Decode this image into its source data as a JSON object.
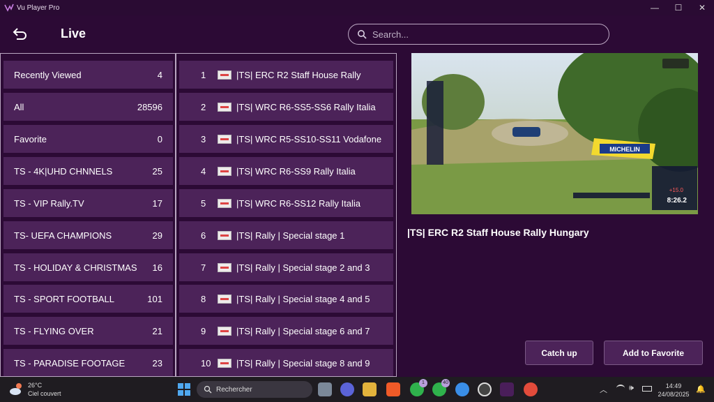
{
  "window": {
    "title": "Vu Player Pro",
    "minimize": "—",
    "maximize": "☐",
    "close": "✕"
  },
  "header": {
    "title": "Live",
    "search_placeholder": "Search..."
  },
  "categories": [
    {
      "name": "Recently Viewed",
      "count": "4"
    },
    {
      "name": "All",
      "count": "28596"
    },
    {
      "name": "Favorite",
      "count": "0"
    },
    {
      "name": "TS - 4K|UHD CHNNELS",
      "count": "25"
    },
    {
      "name": "TS - VIP Rally.TV",
      "count": "17"
    },
    {
      "name": "TS- UEFA CHAMPIONS",
      "count": "29"
    },
    {
      "name": "TS - HOLIDAY & CHRISTMAS",
      "count": "16"
    },
    {
      "name": "TS - SPORT FOOTBALL",
      "count": "101"
    },
    {
      "name": "TS - FLYING OVER",
      "count": "21"
    },
    {
      "name": "TS - PARADISE FOOTAGE",
      "count": "23"
    }
  ],
  "channels": [
    {
      "num": "1",
      "name": "|TS| ERC R2 Staff House Rally"
    },
    {
      "num": "2",
      "name": "|TS| WRC R6-SS5-SS6 Rally Italia"
    },
    {
      "num": "3",
      "name": "|TS| WRC R5-SS10-SS11 Vodafone"
    },
    {
      "num": "4",
      "name": "|TS| WRC R6-SS9 Rally Italia"
    },
    {
      "num": "5",
      "name": "|TS| WRC R6-SS12 Rally Italia"
    },
    {
      "num": "6",
      "name": "|TS| Rally | Special stage 1"
    },
    {
      "num": "7",
      "name": "|TS| Rally | Special stage 2 and 3"
    },
    {
      "num": "8",
      "name": "|TS| Rally | Special stage 4 and 5"
    },
    {
      "num": "9",
      "name": "|TS| Rally | Special stage 6 and 7"
    },
    {
      "num": "10",
      "name": "|TS| Rally | Special stage 8 and 9"
    }
  ],
  "preview": {
    "title": "|TS| ERC R2 Staff House Rally Hungary",
    "sponsor": "MICHELIN",
    "timer": "8:26.2",
    "delta": "+15.0"
  },
  "actions": {
    "catch_up": "Catch up",
    "add_favorite": "Add to Favorite"
  },
  "taskbar": {
    "temperature": "26°C",
    "weather": "Ciel couvert",
    "search": "Rechercher",
    "time": "14:49",
    "date": "24/08/2025",
    "badge_whatsapp": "1",
    "badge_whatsapp2": "40"
  },
  "colors": {
    "background": "#2c0a35",
    "row": "#4c2359",
    "taskbar": "#1f1c21"
  }
}
